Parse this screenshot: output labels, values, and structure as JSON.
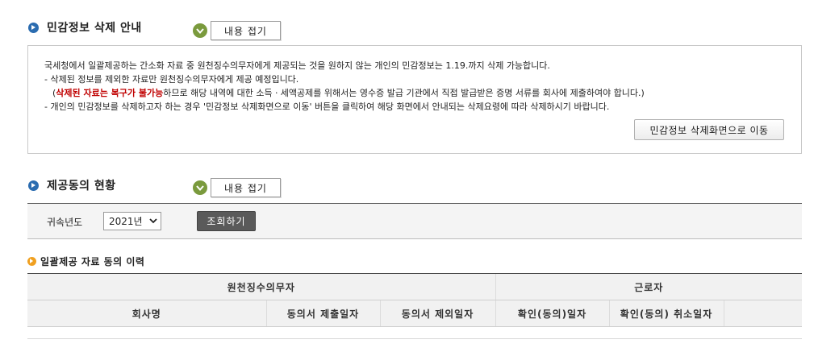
{
  "section1": {
    "title": "민감정보 삭제 안내",
    "toggle_label": "내용 접기",
    "lines": {
      "line1": "국세청에서 일괄제공하는 간소화 자료 중 원천징수의무자에게 제공되는 것을 원하지 않는 개인의 민감정보는 1.19.까지 삭제 가능합니다.",
      "line2": "- 삭제된 정보를 제외한 자료만 원천징수의무자에게 제공 예정입니다.",
      "line3_open": "(",
      "line3_warn": "삭제된 자료는 복구가 불가능",
      "line3_rest": "하므로 해당 내역에 대한 소득ㆍ세액공제를 위해서는 영수증 발급 기관에서 직접 발급받은 증명 서류를 회사에 제출하여야 합니다.)",
      "line4": "- 개인의 민감정보를 삭제하고자 하는 경우 '민감정보 삭제화면으로 이동' 버튼을 클릭하여 해당 화면에서 안내되는 삭제요령에 따라 삭제하시기 바랍니다."
    },
    "goto_button": "민감정보 삭제화면으로 이동"
  },
  "section2": {
    "title": "제공동의 현황",
    "toggle_label": "내용 접기",
    "filter": {
      "label": "귀속년도",
      "selected_year": "2021년",
      "search_button": "조회하기"
    }
  },
  "history": {
    "title": "일괄제공 자료 동의 이력",
    "group_headers": {
      "withholder": "원천징수의무자",
      "worker": "근로자"
    },
    "columns": {
      "company": "회사명",
      "submit_date": "동의서 제출일자",
      "exclude_date": "동의서 제외일자",
      "confirm_date": "확인(동의)일자",
      "cancel_date": "확인(동의) 취소일자"
    }
  },
  "colors": {
    "accent_blue": "#2b6cb0",
    "toggle_green": "#7a9a3d",
    "warning_red": "#c00000",
    "sub_bullet_orange": "#f0a020"
  }
}
